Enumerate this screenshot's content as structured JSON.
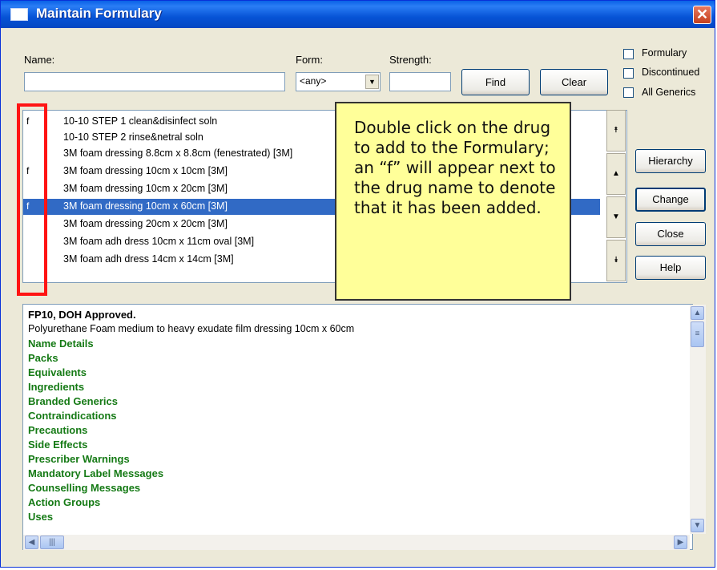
{
  "window": {
    "title": "Maintain Formulary",
    "close_glyph": "✕"
  },
  "search": {
    "name_label": "Name:",
    "name_value": "",
    "form_label": "Form:",
    "form_value": "<any>",
    "strength_label": "Strength:",
    "strength_value": "",
    "find_label": "Find",
    "clear_label": "Clear"
  },
  "filters": [
    {
      "label": "Formulary",
      "checked": false
    },
    {
      "label": "Discontinued",
      "checked": false
    },
    {
      "label": "All Generics",
      "checked": false
    }
  ],
  "side_buttons": {
    "hierarchy": "Hierarchy",
    "change": "Change",
    "close": "Close",
    "help": "Help"
  },
  "drug_list": [
    {
      "flag": "f",
      "name": "10-10 STEP 1 clean&disinfect soln",
      "selected": false
    },
    {
      "flag": "",
      "name": "10-10 STEP 2 rinse&netral soln",
      "selected": false
    },
    {
      "flag": "",
      "name": "3M foam dressing 8.8cm x 8.8cm (fenestrated) [3M]",
      "selected": false
    },
    {
      "flag": "f",
      "name": "3M foam dressing 10cm x 10cm [3M]",
      "selected": false
    },
    {
      "flag": "",
      "name": "3M foam dressing 10cm x 20cm [3M]",
      "selected": false
    },
    {
      "flag": "f",
      "name": "3M foam dressing 10cm x 60cm [3M]",
      "selected": true
    },
    {
      "flag": "",
      "name": "3M foam dressing 20cm x 20cm [3M]",
      "selected": false
    },
    {
      "flag": "",
      "name": "3M foam adh dress 10cm x 11cm oval [3M]",
      "selected": false
    },
    {
      "flag": "",
      "name": "3M foam adh dress 14cm x 14cm [3M]",
      "selected": false
    }
  ],
  "callout": {
    "text": "Double click on the drug to add to the Formulary; an “f” will appear next to the drug name to denote that it has been added."
  },
  "details": {
    "header": "FP10, DOH Approved.",
    "description": "Polyurethane Foam medium to heavy exudate film dressing 10cm x 60cm",
    "links": [
      "Name Details",
      "Packs",
      "Equivalents",
      "Ingredients",
      "Branded Generics",
      "Contraindications",
      "Precautions",
      "Side Effects",
      "Prescriber Warnings",
      "Mandatory Label Messages",
      "Counselling Messages",
      "Action Groups",
      "Uses"
    ]
  },
  "colors": {
    "titlebar": "#0653d6",
    "selection": "#316ac5",
    "highlight": "#ff1414",
    "link": "#157a15",
    "callout": "#ffff99"
  }
}
